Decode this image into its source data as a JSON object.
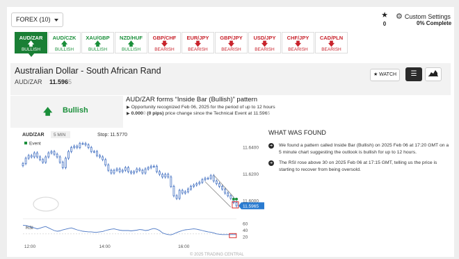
{
  "header": {
    "forex_dropdown": "FOREX (10)",
    "favorites_count": "0",
    "settings_label": "Custom Settings",
    "settings_complete": "0% Complete"
  },
  "tiles": [
    {
      "symbol": "AUD/ZAR",
      "state": "BULLISH",
      "direction": "up",
      "active": true
    },
    {
      "symbol": "AUD/CZK",
      "state": "BULLISH",
      "direction": "up",
      "active": false
    },
    {
      "symbol": "XAU/GBP",
      "state": "BULLISH",
      "direction": "up",
      "active": false
    },
    {
      "symbol": "NZD/HUF",
      "state": "BULLISH",
      "direction": "up",
      "active": false
    },
    {
      "symbol": "GBP/CHF",
      "state": "BEARISH",
      "direction": "down",
      "active": false
    },
    {
      "symbol": "EUR/JPY",
      "state": "BEARISH",
      "direction": "down",
      "active": false
    },
    {
      "symbol": "GBP/JPY",
      "state": "BEARISH",
      "direction": "down",
      "active": false
    },
    {
      "symbol": "USD/JPY",
      "state": "BEARISH",
      "direction": "down",
      "active": false
    },
    {
      "symbol": "CHF/JPY",
      "state": "BEARISH",
      "direction": "down",
      "active": false
    },
    {
      "symbol": "CAD/PLN",
      "state": "BEARISH",
      "direction": "down",
      "active": false
    }
  ],
  "instrument": {
    "name": "Australian Dollar - South African Rand",
    "pair": "AUD/ZAR",
    "price_main": "11.596",
    "price_dim": "5",
    "watch_label": "WATCH"
  },
  "signal": {
    "label": "Bullish"
  },
  "pattern": {
    "title": "AUD/ZAR forms “Inside Bar (Bullish)” pattern",
    "line1": "Opportunity recognized Feb 06, 2025 for the period of up to 12 hours",
    "line2_bold": "0.000",
    "line2_dim": "0",
    "line2_bold2": " (0 pips)",
    "line2_rest": " price change since the Technical Event at 11.596",
    "line2_end_dim": "5"
  },
  "chart_data": {
    "type": "candlestick",
    "symbol_label": "AUD/ZAR",
    "timeframe_label": "5 MIN",
    "stop_label": "Stop: 11.5770",
    "legend_event": "Event",
    "price_ticks": [
      "11.6400",
      "11.6200",
      "11.6000"
    ],
    "price_tick_values": [
      11.64,
      11.62,
      11.6
    ],
    "current_price_label": "11.5965",
    "current_price": 11.5965,
    "ylim": [
      11.5915,
      11.6475
    ],
    "x_ticks": [
      "12:00",
      "14:00",
      "16:00"
    ],
    "rsi_label": "RSI",
    "rsi_ticks": [
      "60",
      "40",
      "20"
    ],
    "rsi_tick_values": [
      60,
      40,
      20
    ],
    "rsi_ylim": [
      15,
      65
    ],
    "copyright": "© 2025 TRADING CENTRAL",
    "close_series": [
      11.628,
      11.632,
      11.634,
      11.633,
      11.636,
      11.633,
      11.631,
      11.629,
      11.633,
      11.636,
      11.637,
      11.635,
      11.633,
      11.629,
      11.625,
      11.632,
      11.637,
      11.64,
      11.641,
      11.64,
      11.643,
      11.643,
      11.642,
      11.64,
      11.637,
      11.637,
      11.634,
      11.633,
      11.631,
      11.627,
      11.623,
      11.621,
      11.623,
      11.624,
      11.622,
      11.623,
      11.625,
      11.622,
      11.621,
      11.622,
      11.624,
      11.623,
      11.621,
      11.624,
      11.625,
      11.626,
      11.626,
      11.622,
      11.62,
      11.618,
      11.62,
      11.618,
      11.611,
      11.604,
      11.602,
      11.608,
      11.606,
      11.607,
      11.609,
      11.611,
      11.612,
      11.613,
      11.614,
      11.616,
      11.617,
      11.617,
      11.619,
      11.615,
      11.613,
      11.611,
      11.609,
      11.606,
      11.604,
      11.602,
      11.599,
      11.5965
    ],
    "rsi_series": [
      56,
      55,
      53,
      50,
      48,
      45,
      47,
      50,
      52,
      48,
      44,
      40,
      38,
      39,
      42,
      44,
      46,
      48,
      45,
      42,
      40,
      38,
      37,
      36,
      36,
      35,
      35,
      36,
      37,
      40,
      42,
      44,
      45,
      43,
      41,
      40,
      40,
      40,
      39,
      40,
      41,
      43,
      42,
      40,
      41,
      44,
      46,
      44,
      40,
      33,
      30,
      28,
      27,
      30,
      34,
      37,
      40,
      42,
      43,
      44,
      45,
      44,
      42,
      40,
      38,
      36,
      35,
      33,
      30,
      29,
      28,
      28,
      28,
      28,
      28,
      28
    ]
  },
  "found": {
    "heading": "WHAT WAS FOUND",
    "items": [
      "We found a pattern called Inside Bar (Bullish) on 2025 Feb 06 at 17:20 GMT on a 5 minute chart suggesting the outlook is bullish for up to 12 hours.",
      "The RSI rose above 30 on 2025 Feb 06 at 17:15 GMT, telling us the price is starting to recover from being oversold."
    ]
  },
  "colors": {
    "bullish": "#1a8f3a",
    "bearish": "#c8232c",
    "candle": "#4a76c4",
    "price_tag": "#2a7bd0"
  }
}
